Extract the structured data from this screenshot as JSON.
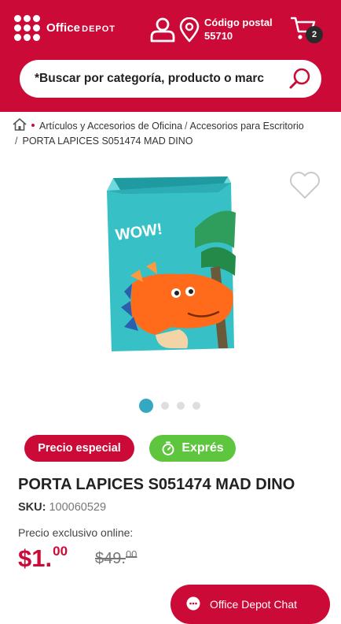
{
  "header": {
    "brand": "Office",
    "brand_sub": "DEPOT",
    "postal_label": "Código postal",
    "postal_code": "55710",
    "cart_count": "2",
    "accent_color": "#cc0a37"
  },
  "search": {
    "placeholder": "*Buscar por categoría, producto o marc"
  },
  "breadcrumb": {
    "items": [
      "Artículos y Accesorios de Oficina",
      "Accesorios para Escritorio"
    ],
    "current": "PORTA LAPICES S051474 MAD DINO"
  },
  "product": {
    "image_text": "WOW!",
    "carousel_count": 4,
    "carousel_active": 1,
    "badge_special": "Precio especial",
    "badge_express": "Exprés",
    "title": "PORTA LAPICES S051474 MAD DINO",
    "sku_label": "SKU:",
    "sku_value": "100060529",
    "online_label": "Precio exclusivo online:",
    "price_main": "$1.",
    "price_cents": "00",
    "old_price_main": "$49.",
    "old_price_cents": "00"
  },
  "chat": {
    "label": "Office Depot Chat"
  }
}
